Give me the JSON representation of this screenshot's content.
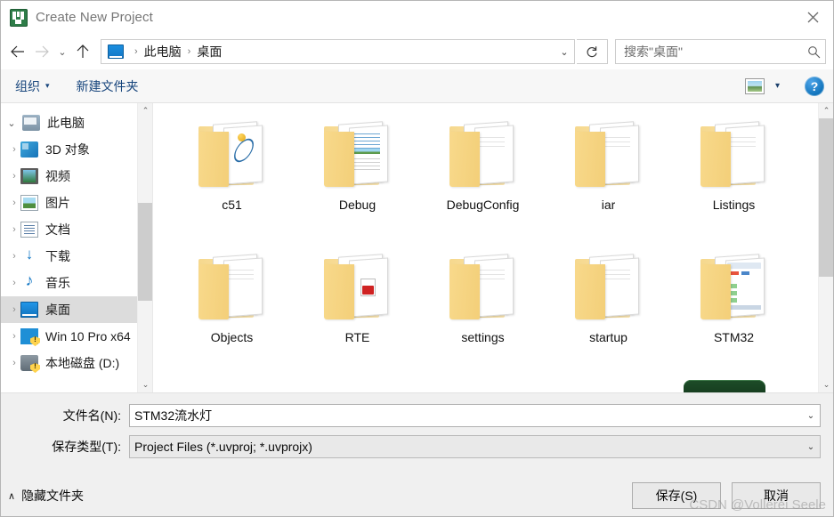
{
  "window": {
    "title": "Create New Project",
    "app_icon": "keil-uvision-icon",
    "close_label": "✕"
  },
  "nav": {
    "back_icon": "arrow-left-icon",
    "forward_icon": "arrow-right-icon",
    "recent_icon": "chevron-down-icon",
    "up_icon": "arrow-up-icon",
    "refresh_icon": "refresh-icon",
    "breadcrumb": {
      "icon": "desktop-icon",
      "items": [
        "此电脑",
        "桌面"
      ],
      "separator": "›",
      "caret": "⌄"
    }
  },
  "search": {
    "placeholder": "搜索\"桌面\"",
    "icon": "search-icon"
  },
  "commandbar": {
    "organize_label": "组织",
    "organize_caret": "▾",
    "new_folder_label": "新建文件夹",
    "view_icon": "view-options-icon",
    "view_caret": "▾",
    "help_label": "?"
  },
  "sidebar": {
    "items": [
      {
        "label": "此电脑",
        "icon": "computer-icon",
        "level": 0,
        "twisty": "⌄",
        "selected": false,
        "shield": false
      },
      {
        "label": "3D 对象",
        "icon": "3d-objects-icon",
        "level": 1,
        "twisty": "›",
        "selected": false,
        "shield": false
      },
      {
        "label": "视频",
        "icon": "videos-icon",
        "level": 1,
        "twisty": "›",
        "selected": false,
        "shield": false
      },
      {
        "label": "图片",
        "icon": "pictures-icon",
        "level": 1,
        "twisty": "›",
        "selected": false,
        "shield": false
      },
      {
        "label": "文档",
        "icon": "documents-icon",
        "level": 1,
        "twisty": "›",
        "selected": false,
        "shield": false
      },
      {
        "label": "下载",
        "icon": "downloads-icon",
        "level": 1,
        "twisty": "›",
        "selected": false,
        "shield": false
      },
      {
        "label": "音乐",
        "icon": "music-icon",
        "level": 1,
        "twisty": "›",
        "selected": false,
        "shield": false
      },
      {
        "label": "桌面",
        "icon": "desktop-icon",
        "level": 1,
        "twisty": "›",
        "selected": true,
        "shield": false
      },
      {
        "label": "Win 10 Pro x64",
        "icon": "windows-drive-icon",
        "level": 1,
        "twisty": "›",
        "selected": false,
        "shield": true
      },
      {
        "label": "本地磁盘 (D:)",
        "icon": "local-disk-icon",
        "level": 1,
        "twisty": "›",
        "selected": false,
        "shield": true
      }
    ],
    "scrollbar": {
      "up": "⌃",
      "down": "⌄"
    }
  },
  "files": {
    "items": [
      {
        "name": "c51",
        "icon": "folder-icon",
        "preview": "pv-atom"
      },
      {
        "name": "Debug",
        "icon": "folder-icon",
        "preview": "pv-lines"
      },
      {
        "name": "DebugConfig",
        "icon": "folder-icon",
        "preview": "pv-plain"
      },
      {
        "name": "iar",
        "icon": "folder-icon",
        "preview": "pv-plain"
      },
      {
        "name": "Listings",
        "icon": "folder-icon",
        "preview": "pv-plain"
      },
      {
        "name": "Objects",
        "icon": "folder-icon",
        "preview": "pv-plain"
      },
      {
        "name": "RTE",
        "icon": "folder-icon",
        "preview": "pv-pdf"
      },
      {
        "name": "settings",
        "icon": "folder-icon",
        "preview": "pv-plain"
      },
      {
        "name": "startup",
        "icon": "folder-icon",
        "preview": "pv-plain"
      },
      {
        "name": "STM32",
        "icon": "folder-icon",
        "preview": "pv-shot"
      }
    ],
    "scrollbar": {
      "up": "⌃",
      "down": "⌄"
    }
  },
  "form": {
    "filename_label": "文件名(N):",
    "filename_value": "STM32流水灯",
    "filetype_label": "保存类型(T):",
    "filetype_value": "Project Files (*.uvproj; *.uvprojx)",
    "dropdown_caret": "⌄"
  },
  "footer": {
    "hide_folders_caret": "∧",
    "hide_folders_label": "隐藏文件夹",
    "save_label": "保存(S)",
    "cancel_label": "取消"
  },
  "watermark": "CSDN @Vollerei Seele",
  "colors": {
    "accent_blue": "#17457c",
    "selection_gray": "#dcdcdc",
    "folder_yellow": "#f6d88d",
    "chrome_gray": "#f0f0f0"
  }
}
